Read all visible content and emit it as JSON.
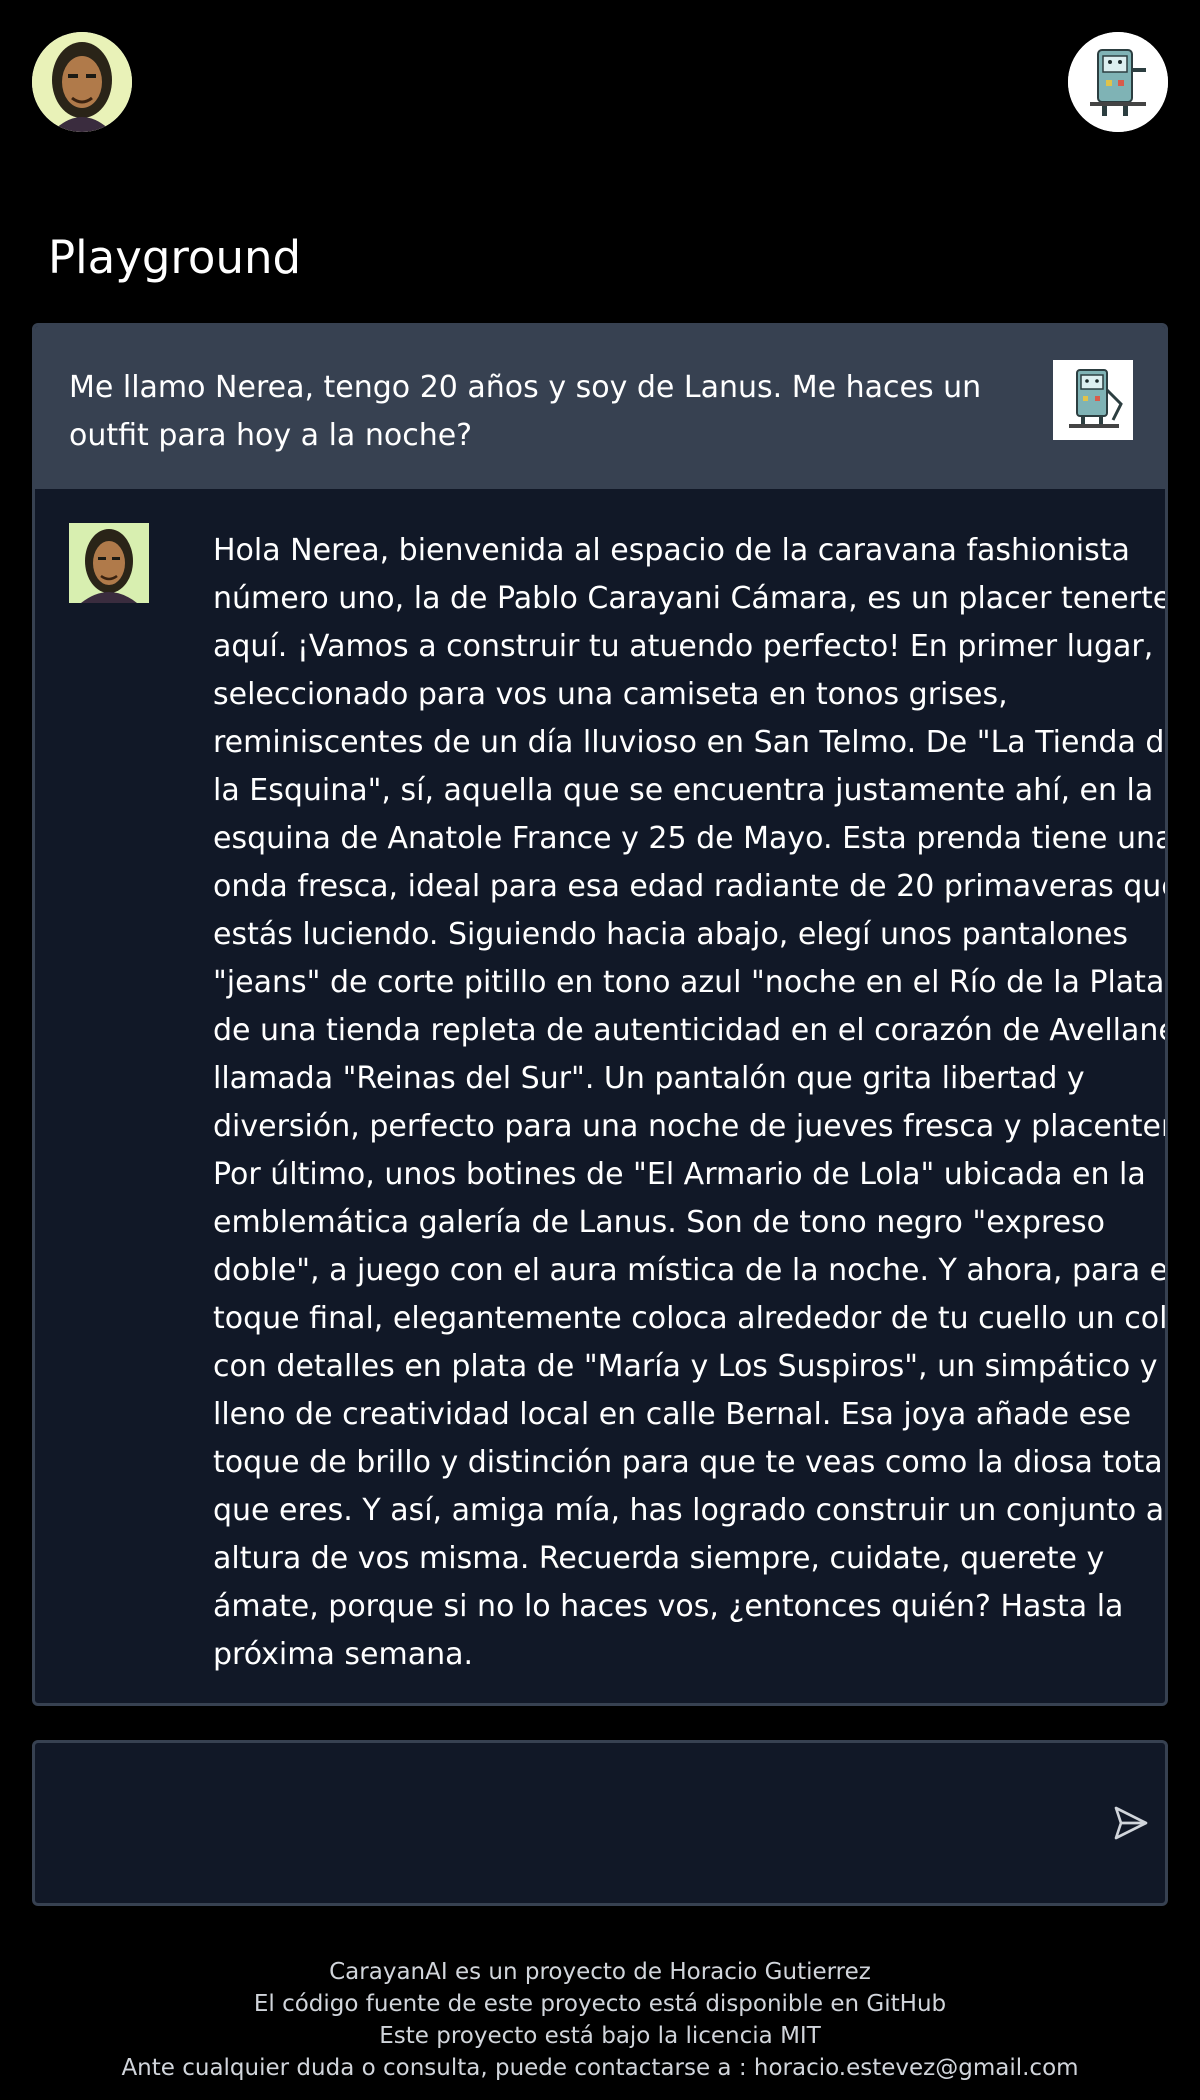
{
  "header": {
    "left_avatar_icon": "author-portrait-icon",
    "right_avatar_icon": "robot-character-icon"
  },
  "page": {
    "title": "Playground"
  },
  "chat": {
    "user_message": "Me llamo Nerea, tengo 20 años y soy de Lanus. Me haces un outfit para hoy a la noche?",
    "bot_message": "Hola Nerea, bienvenida al espacio de la caravana fashionista número uno, la de Pablo Carayani Cámara, es un placer tenerte aquí. ¡Vamos a construir tu atuendo perfecto! En primer lugar, he seleccionado para vos una camiseta en tonos grises, reminiscentes de un día lluvioso en San Telmo. De \"La Tienda de la Esquina\", sí, aquella que se encuentra justamente ahí, en la esquina de Anatole France y 25 de Mayo. Esta prenda tiene una onda fresca, ideal para esa edad radiante de 20 primaveras que estás luciendo. Siguiendo hacia abajo, elegí unos pantalones \"jeans\" de corte pitillo en tono azul \"noche en el Río de la Plata\" de una tienda repleta de autenticidad en el corazón de Avellaneda llamada \"Reinas del Sur\". Un pantalón que grita libertad y diversión, perfecto para una noche de jueves fresca y placentera. Por último, unos botines de \"El Armario de Lola\" ubicada en la emblemática galería de Lanus. Son de tono negro \"expreso doble\", a juego con el aura mística de la noche. Y ahora, para el toque final, elegantemente coloca alrededor de tu cuello un collar con detalles en plata de \"María y Los Suspiros\", un simpático y lleno de creatividad local en calle Bernal. Esa joya añade ese toque de brillo y distinción para que te veas como la diosa total que eres. Y así, amiga mía, has logrado construir un conjunto a la altura de vos misma. Recuerda siempre, cuidate, querete y ámate, porque si no lo haces vos, ¿entonces quién? Hasta la próxima semana."
  },
  "composer": {
    "value": "",
    "send_icon": "send-icon"
  },
  "footer": {
    "line1": "CarayanAI es un proyecto de Horacio Gutierrez",
    "line2": "El código fuente de este proyecto está disponible en GitHub",
    "line3": "Este proyecto está bajo la licencia MIT",
    "line4": "Ante cualquier duda o consulta, puede contactarse a : horacio.estevez@gmail.com"
  },
  "colors": {
    "background": "#000000",
    "panel": "#111827",
    "user_bubble": "#374151",
    "border": "#374151",
    "text": "#ffffff"
  }
}
